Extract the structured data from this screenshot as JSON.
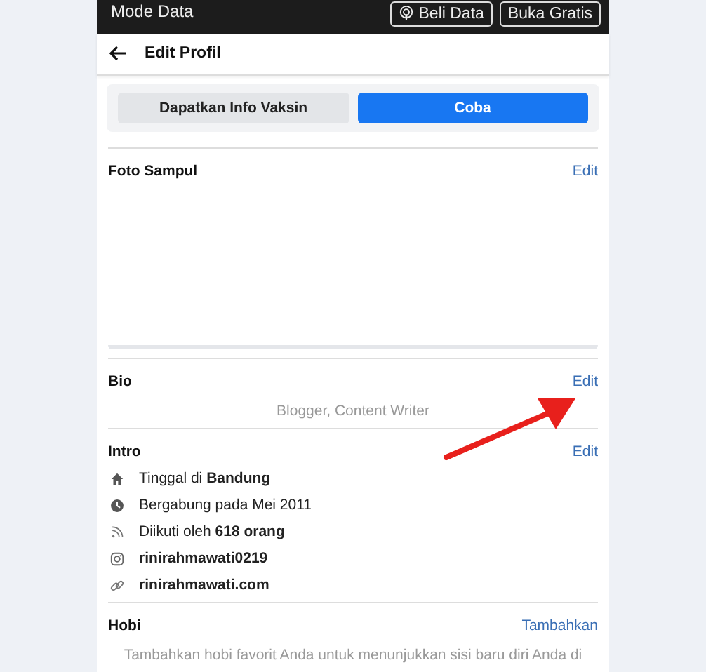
{
  "status_bar": {
    "title": "Mode Data",
    "buttons": [
      {
        "label": "Beli Data",
        "kind": "broadcast"
      },
      {
        "label": "Buka Gratis",
        "kind": "plain"
      }
    ]
  },
  "header": {
    "title": "Edit Profil"
  },
  "promo": {
    "buttons": [
      {
        "label": "Dapatkan Info Vaksin",
        "primary": false
      },
      {
        "label": "Coba",
        "primary": true
      }
    ]
  },
  "sections": [
    {
      "title": "Foto Sampul",
      "action": "Edit",
      "kind": "cover"
    },
    {
      "title": "Bio",
      "action": "Edit",
      "kind": "text",
      "text": "Blogger, Content Writer"
    },
    {
      "title": "Intro",
      "action": "Edit",
      "kind": "list",
      "items": [
        {
          "kind": "home",
          "text": "Tinggal di **Bandung**"
        },
        {
          "kind": "clock",
          "text": "Bergabung pada Mei 2011"
        },
        {
          "kind": "rss",
          "text": "Diikuti oleh **618 orang**"
        },
        {
          "kind": "instagram",
          "text": "**rinirahmawati0219**"
        },
        {
          "kind": "link",
          "text": "**rinirahmawati.com**"
        }
      ]
    },
    {
      "title": "Hobi",
      "action": "Tambahkan",
      "kind": "text",
      "text": "Tambahkan hobi favorit Anda untuk menunjukkan sisi baru diri Anda di"
    }
  ]
}
